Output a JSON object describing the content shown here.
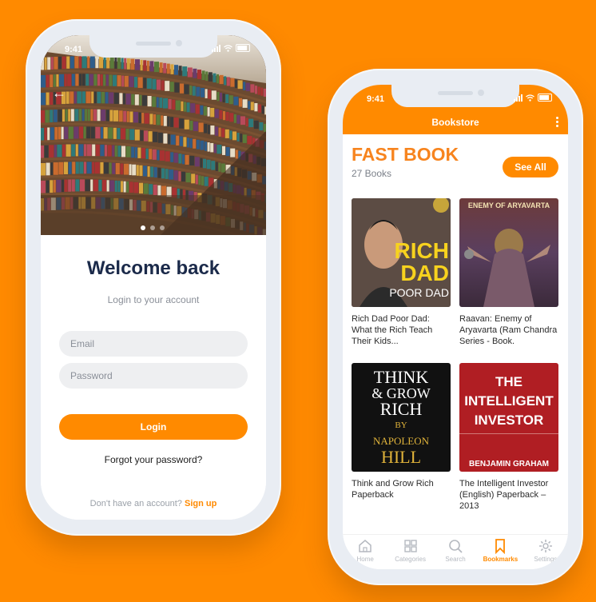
{
  "status": {
    "time_left": "9:41",
    "time_right": "9:41"
  },
  "login": {
    "welcome": "Welcome back",
    "subtitle": "Login to your account",
    "email_placeholder": "Email",
    "password_placeholder": "Password",
    "login_label": "Login",
    "forgot": "Forgot your password?",
    "no_account": "Don't have an account?",
    "signup": "Sign up",
    "carousel_active": 0,
    "carousel_total": 3
  },
  "store": {
    "app_title": "Bookstore",
    "section_title": "FAST BOOK",
    "book_count": "27 Books",
    "see_all": "See All",
    "books": [
      {
        "title": "Rich Dad Poor Dad: What the Rich Teach Their Kids...",
        "cover_lines": [
          "RICH",
          "DAD",
          "POOR DAD"
        ],
        "cover_color": "#5A4A42"
      },
      {
        "title": "Raavan: Enemy of Aryavarta (Ram Chandra Series - Book.",
        "cover_lines": [
          "ENEMY OF ARYAVARTA"
        ],
        "cover_color": "#7A3A3A"
      },
      {
        "title": "Think and Grow Rich Paperback",
        "cover_lines": [
          "THINK",
          "& GROW",
          "RICH",
          "BY",
          "NAPOLEON",
          "HILL"
        ],
        "cover_color": "#111111"
      },
      {
        "title": "The Intelligent Investor (English) Paperback – 2013",
        "cover_lines": [
          "THE",
          "INTELLIGENT",
          "INVESTOR",
          "BENJAMIN GRAHAM"
        ],
        "cover_color": "#B01E23"
      }
    ],
    "tabs": [
      {
        "label": "Home",
        "icon": "home-icon",
        "active": false
      },
      {
        "label": "Categories",
        "icon": "grid-icon",
        "active": false
      },
      {
        "label": "Search",
        "icon": "search-icon",
        "active": false
      },
      {
        "label": "Bookmarks",
        "icon": "bookmark-icon",
        "active": true
      },
      {
        "label": "Settings",
        "icon": "gear-icon",
        "active": false
      }
    ]
  },
  "colors": {
    "accent": "#FF8A00",
    "background": "#FF8A00",
    "heading": "#1B2A4A"
  }
}
